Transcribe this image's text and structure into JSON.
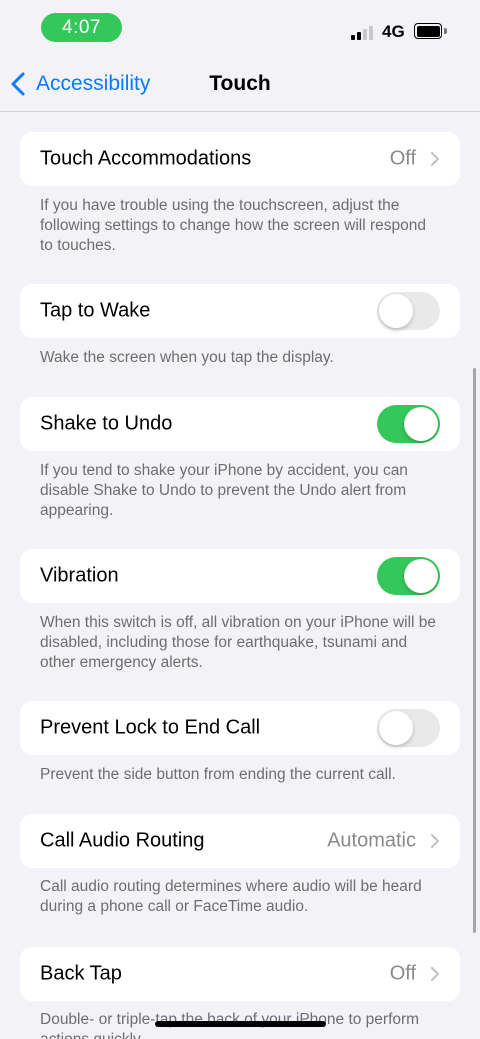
{
  "status_bar": {
    "time": "4:07",
    "network": "4G"
  },
  "nav": {
    "back_label": "Accessibility",
    "title": "Touch"
  },
  "rows": {
    "touch_accommodations": {
      "label": "Touch Accommodations",
      "value": "Off"
    },
    "touch_accommodations_footer": "If you have trouble using the touchscreen, adjust the following settings to change how the screen will respond to touches.",
    "tap_to_wake": {
      "label": "Tap to Wake",
      "on": false
    },
    "tap_to_wake_footer": "Wake the screen when you tap the display.",
    "shake_to_undo": {
      "label": "Shake to Undo",
      "on": true
    },
    "shake_to_undo_footer": "If you tend to shake your iPhone by accident, you can disable Shake to Undo to prevent the Undo alert from appearing.",
    "vibration": {
      "label": "Vibration",
      "on": true
    },
    "vibration_footer": "When this switch is off, all vibration on your iPhone will be disabled, including those for earthquake, tsunami and other emergency alerts.",
    "prevent_lock": {
      "label": "Prevent Lock to End Call",
      "on": false
    },
    "prevent_lock_footer": "Prevent the side button from ending the current call.",
    "call_audio_routing": {
      "label": "Call Audio Routing",
      "value": "Automatic"
    },
    "call_audio_routing_footer": "Call audio routing determines where audio will be heard during a phone call or FaceTime audio.",
    "back_tap": {
      "label": "Back Tap",
      "value": "Off"
    },
    "back_tap_footer": "Double- or triple-tap the back of your iPhone to perform actions quickly."
  },
  "colors": {
    "accent": "#0a7aff",
    "toggle_on": "#34c759",
    "background": "#f2f2f7"
  }
}
